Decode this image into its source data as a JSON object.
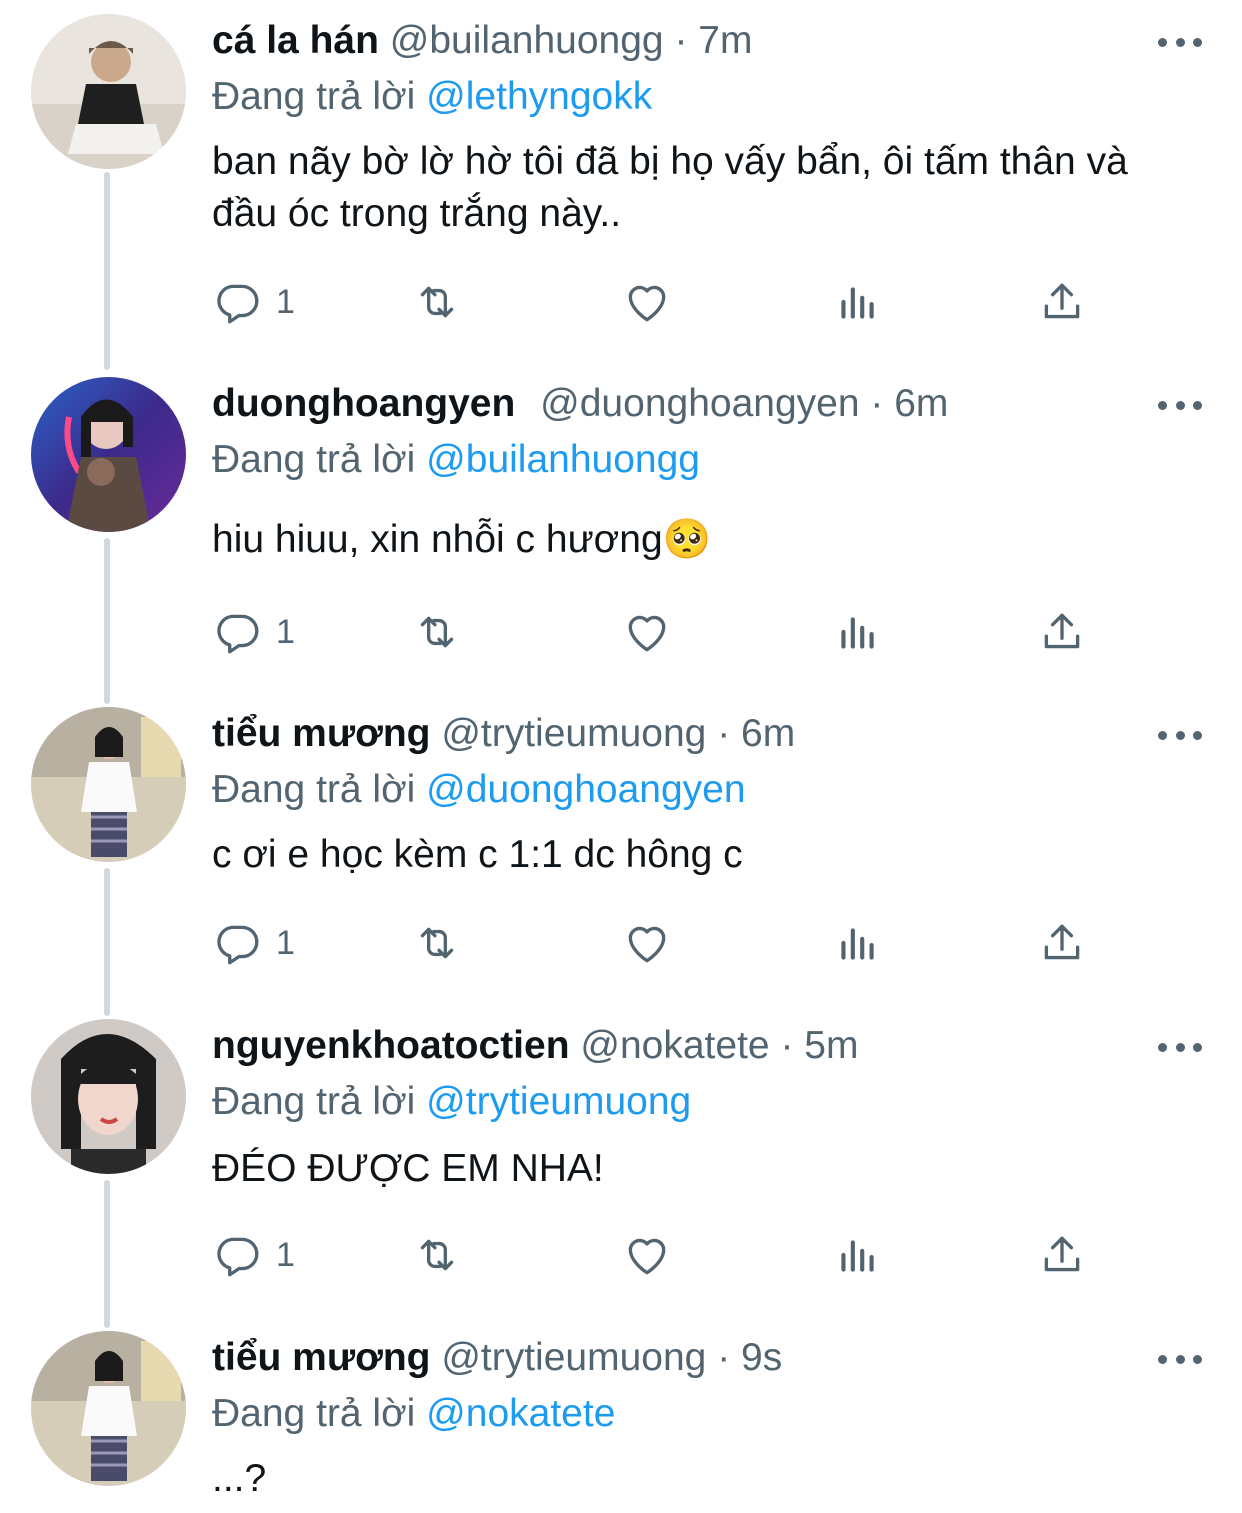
{
  "tweets": [
    {
      "name": "cá la hán",
      "handle": "@builanhuongg",
      "separator": "·",
      "time": "7m",
      "replying_label": "Đang trả lời",
      "replying_to": "@lethyngokk",
      "text": "ban nãy bờ lờ hờ tôi đã bị họ vấy bẩn, ôi tấm thân và đầu óc trong trắng này..",
      "reply_count": "1"
    },
    {
      "name": "duonghoangyen",
      "handle": "@duonghoangyen",
      "separator": "·",
      "time": "6m",
      "replying_label": "Đang trả lời",
      "replying_to": "@builanhuongg",
      "text": "hiu hiuu, xin nhỗi c hương🥺",
      "reply_count": "1"
    },
    {
      "name": "tiểu mương",
      "handle": "@trytieumuong",
      "separator": "·",
      "time": "6m",
      "replying_label": "Đang trả lời",
      "replying_to": "@duonghoangyen",
      "text": "c ơi e học kèm c 1:1 dc hông c",
      "reply_count": "1"
    },
    {
      "name": "nguyenkhoatoctien",
      "handle": "@nokatete",
      "separator": "·",
      "time": "5m",
      "replying_label": "Đang trả lời",
      "replying_to": "@trytieumuong",
      "text": "ĐÉO ĐƯỢC EM NHA!",
      "reply_count": "1"
    },
    {
      "name": "tiểu mương",
      "handle": "@trytieumuong",
      "separator": "·",
      "time": "9s",
      "replying_label": "Đang trả lời",
      "replying_to": "@nokatete",
      "text": "...?",
      "reply_count": ""
    }
  ],
  "icons": {
    "reply": "reply-icon",
    "retweet": "retweet-icon",
    "like": "like-icon",
    "views": "views-icon",
    "share": "share-icon",
    "more": "more-icon"
  },
  "colors": {
    "primary_text": "#0f1419",
    "secondary_text": "#536471",
    "link": "#1d9bf0",
    "thread_line": "#cfd9de"
  }
}
